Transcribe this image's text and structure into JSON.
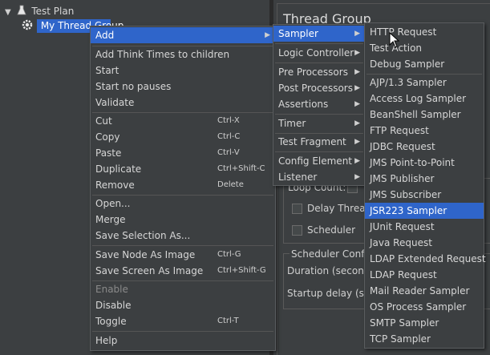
{
  "tree": {
    "root_label": "Test Plan",
    "child_label": "My Thread Group"
  },
  "right_panel": {
    "title": "Thread Group",
    "loop_count": "Loop Count:",
    "delay_thread": "Delay Thread",
    "scheduler": "Scheduler",
    "scheduler_config": "Scheduler Config",
    "duration": "Duration (seconds",
    "startup_delay": "Startup delay (sec"
  },
  "context_menu": {
    "items": [
      {
        "label": "Add"
      },
      {
        "label": "Add Think Times to children"
      },
      {
        "label": "Start"
      },
      {
        "label": "Start no pauses"
      },
      {
        "label": "Validate"
      },
      {
        "label": "Cut",
        "shortcut": "Ctrl-X"
      },
      {
        "label": "Copy",
        "shortcut": "Ctrl-C"
      },
      {
        "label": "Paste",
        "shortcut": "Ctrl-V"
      },
      {
        "label": "Duplicate",
        "shortcut": "Ctrl+Shift-C"
      },
      {
        "label": "Remove",
        "shortcut": "Delete"
      },
      {
        "label": "Open..."
      },
      {
        "label": "Merge"
      },
      {
        "label": "Save Selection As..."
      },
      {
        "label": "Save Node As Image",
        "shortcut": "Ctrl-G"
      },
      {
        "label": "Save Screen As Image",
        "shortcut": "Ctrl+Shift-G"
      },
      {
        "label": "Enable"
      },
      {
        "label": "Disable"
      },
      {
        "label": "Toggle",
        "shortcut": "Ctrl-T"
      },
      {
        "label": "Help"
      }
    ]
  },
  "add_submenu": {
    "items": [
      {
        "label": "Sampler"
      },
      {
        "label": "Logic Controller"
      },
      {
        "label": "Pre Processors"
      },
      {
        "label": "Post Processors"
      },
      {
        "label": "Assertions"
      },
      {
        "label": "Timer"
      },
      {
        "label": "Test Fragment"
      },
      {
        "label": "Config Element"
      },
      {
        "label": "Listener"
      }
    ]
  },
  "sampler_submenu": {
    "items": [
      {
        "label": "HTTP Request"
      },
      {
        "label": "Test Action"
      },
      {
        "label": "Debug Sampler"
      },
      {
        "label": "AJP/1.3 Sampler"
      },
      {
        "label": "Access Log Sampler"
      },
      {
        "label": "BeanShell Sampler"
      },
      {
        "label": "FTP Request"
      },
      {
        "label": "JDBC Request"
      },
      {
        "label": "JMS Point-to-Point"
      },
      {
        "label": "JMS Publisher"
      },
      {
        "label": "JMS Subscriber"
      },
      {
        "label": "JSR223 Sampler"
      },
      {
        "label": "JUnit Request"
      },
      {
        "label": "Java Request"
      },
      {
        "label": "LDAP Extended Request"
      },
      {
        "label": "LDAP Request"
      },
      {
        "label": "Mail Reader Sampler"
      },
      {
        "label": "OS Process Sampler"
      },
      {
        "label": "SMTP Sampler"
      },
      {
        "label": "TCP Sampler"
      }
    ]
  },
  "colors": {
    "highlight": "#2f65ca",
    "background": "#3c3f41"
  }
}
